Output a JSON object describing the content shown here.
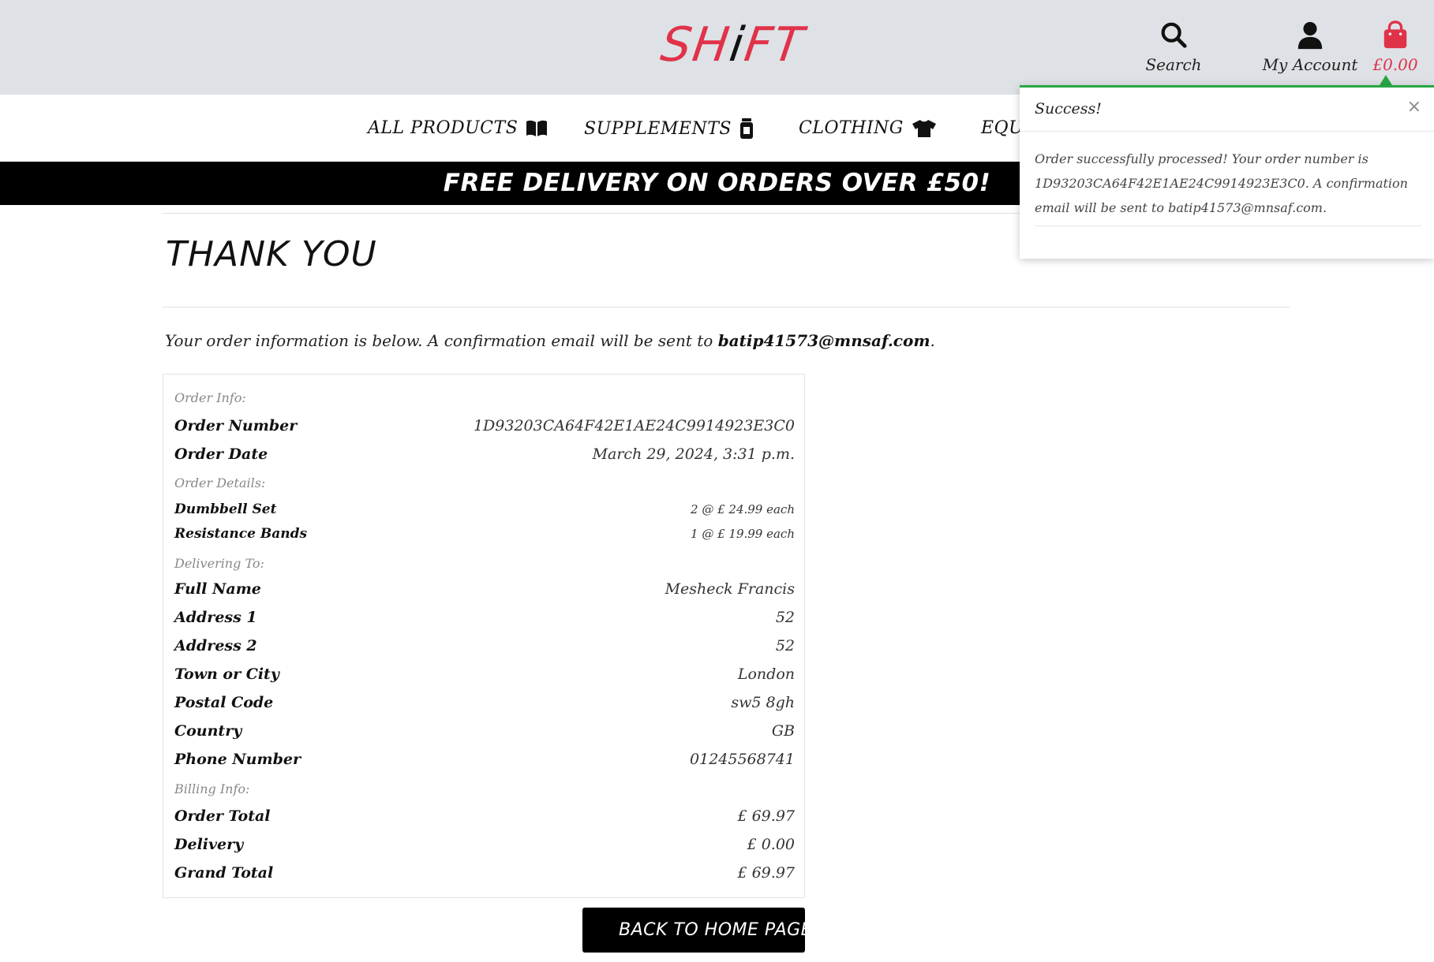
{
  "header": {
    "logo_left": "SH",
    "logo_mid": "i",
    "logo_right": "FT",
    "search_label": "Search",
    "account_label": "My Account",
    "bag_total": "£0.00"
  },
  "nav": {
    "all_products": "ALL PRODUCTS",
    "supplements": "SUPPLEMENTS",
    "clothing": "CLOTHING",
    "equipment": "EQUI"
  },
  "banner": {
    "text": "FREE DELIVERY ON ORDERS OVER £50!"
  },
  "page": {
    "title": "THANK YOU",
    "intro_text": "Your order information is below. A confirmation email will be sent to",
    "intro_email": "batip41573@mnsaf.com",
    "intro_end": "."
  },
  "order": {
    "order_info_heading": "Order Info:",
    "order_number_label": "Order Number",
    "order_number": "1D93203CA64F42E1AE24C9914923E3C0",
    "order_date_label": "Order Date",
    "order_date": "March 29, 2024, 3:31 p.m.",
    "order_details_heading": "Order Details:",
    "items": [
      {
        "name": "Dumbbell Set",
        "detail": "2 @ £ 24.99 each"
      },
      {
        "name": "Resistance Bands",
        "detail": "1 @ £ 19.99 each"
      }
    ],
    "delivering_heading": "Delivering To:",
    "delivery": [
      {
        "label": "Full Name",
        "value": "Mesheck Francis"
      },
      {
        "label": "Address 1",
        "value": "52"
      },
      {
        "label": "Address 2",
        "value": "52"
      },
      {
        "label": "Town or City",
        "value": "London"
      },
      {
        "label": "Postal Code",
        "value": "sw5 8gh"
      },
      {
        "label": "Country",
        "value": "GB"
      },
      {
        "label": "Phone Number",
        "value": "01245568741"
      }
    ],
    "billing_heading": "Billing Info:",
    "billing": [
      {
        "label": "Order Total",
        "value": "£ 69.97"
      },
      {
        "label": "Delivery",
        "value": "£ 0.00"
      },
      {
        "label": "Grand Total",
        "value": "£ 69.97"
      }
    ]
  },
  "back_button": {
    "label": "BACK TO HOME PAGE"
  },
  "toast": {
    "title": "Success!",
    "close": "×",
    "message": "Order successfully processed! Your order number is 1D93203CA64F42E1AE24C9914923E3C0. A confirmation email will be sent to batip41573@mnsaf.com."
  },
  "colors": {
    "brand_red": "#e0334a",
    "header_bg": "#dee2e6",
    "success_green": "#28a745",
    "banner_bg": "#000000"
  }
}
